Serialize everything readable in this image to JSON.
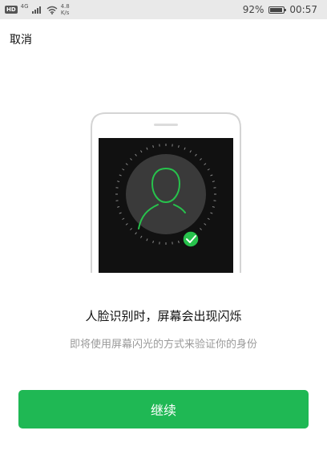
{
  "status_bar": {
    "badge": "HD",
    "network": "4G",
    "speed_value": "4.8",
    "speed_unit": "K/s",
    "battery_percent_text": "92%",
    "battery_level": 0.92,
    "time": "00:57",
    "icons": [
      "hd-icon",
      "signal-icon",
      "wifi-icon",
      "battery-icon"
    ]
  },
  "header": {
    "cancel_label": "取消"
  },
  "content": {
    "title": "人脸识别时，屏幕会出现闪烁",
    "subtitle": "即将使用屏幕闪光的方式来验证你的身份"
  },
  "actions": {
    "continue_label": "继续"
  },
  "colors": {
    "accent": "#1fb854",
    "face_outline": "#27c24c",
    "screen": "#111111",
    "subtitle": "#9a9a9a"
  }
}
